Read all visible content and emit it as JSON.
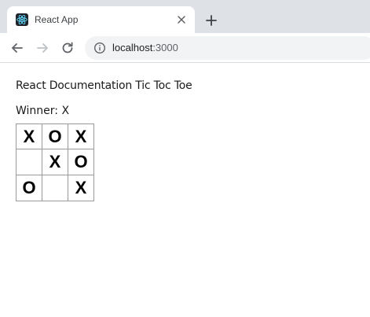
{
  "browser": {
    "tab": {
      "title": "React App",
      "favicon": "react-logo-icon",
      "close_icon": "close-icon"
    },
    "new_tab_icon": "plus-icon",
    "nav": {
      "back_icon": "arrow-left-icon",
      "forward_icon": "arrow-right-icon",
      "reload_icon": "reload-icon"
    },
    "address": {
      "info_icon": "info-icon",
      "host": "localhost",
      "port": ":3000"
    }
  },
  "app": {
    "heading": "React Documentation Tic Toc Toe",
    "status": "Winner: X",
    "board": {
      "rows": [
        [
          "X",
          "O",
          "X"
        ],
        [
          "",
          "X",
          "O"
        ],
        [
          "O",
          "",
          "X"
        ]
      ]
    }
  }
}
